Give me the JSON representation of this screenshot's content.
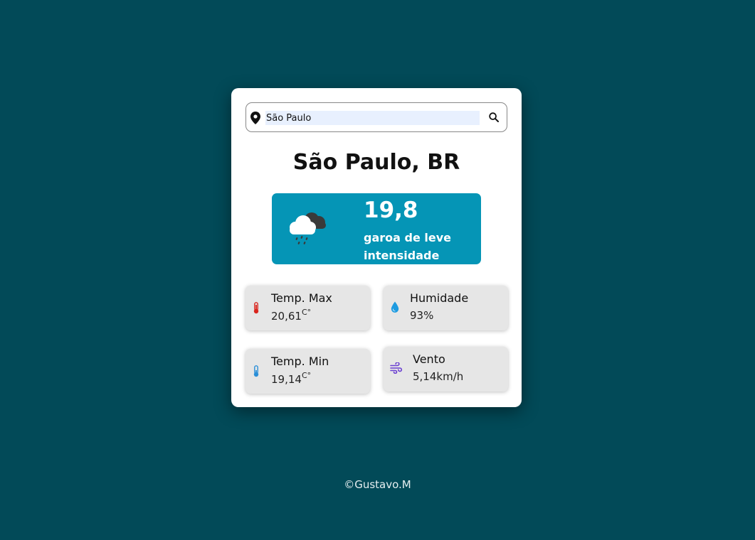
{
  "search": {
    "value": "São Paulo",
    "placeholder": ""
  },
  "location": {
    "title": "São Paulo, BR"
  },
  "current": {
    "temperature": "19,8",
    "description": "garoa de leve intensidade"
  },
  "stats": {
    "temp_max": {
      "label": "Temp. Max",
      "value": "20,61",
      "unit": "C°"
    },
    "humidity": {
      "label": "Humidade",
      "value": "93%"
    },
    "temp_min": {
      "label": "Temp. Min",
      "value": "19,14",
      "unit": "C°"
    },
    "wind": {
      "label": "Vento",
      "value": "5,14km/h"
    }
  },
  "footer": {
    "text": "©Gustavo.M"
  },
  "colors": {
    "background": "#024a58",
    "weather_panel": "#0595b6",
    "temp_max_icon": "#d9251d",
    "temp_min_icon": "#2a8fd8",
    "humidity_icon": "#1e9be0",
    "wind_icon": "#6a3fd1"
  },
  "icons": {
    "search_pin": "map-pin-icon",
    "search_button": "search-icon",
    "weather": "cloud-rain-icon",
    "temp_max": "thermometer-hot-icon",
    "temp_min": "thermometer-cold-icon",
    "humidity": "water-drop-icon",
    "wind": "wind-icon"
  }
}
